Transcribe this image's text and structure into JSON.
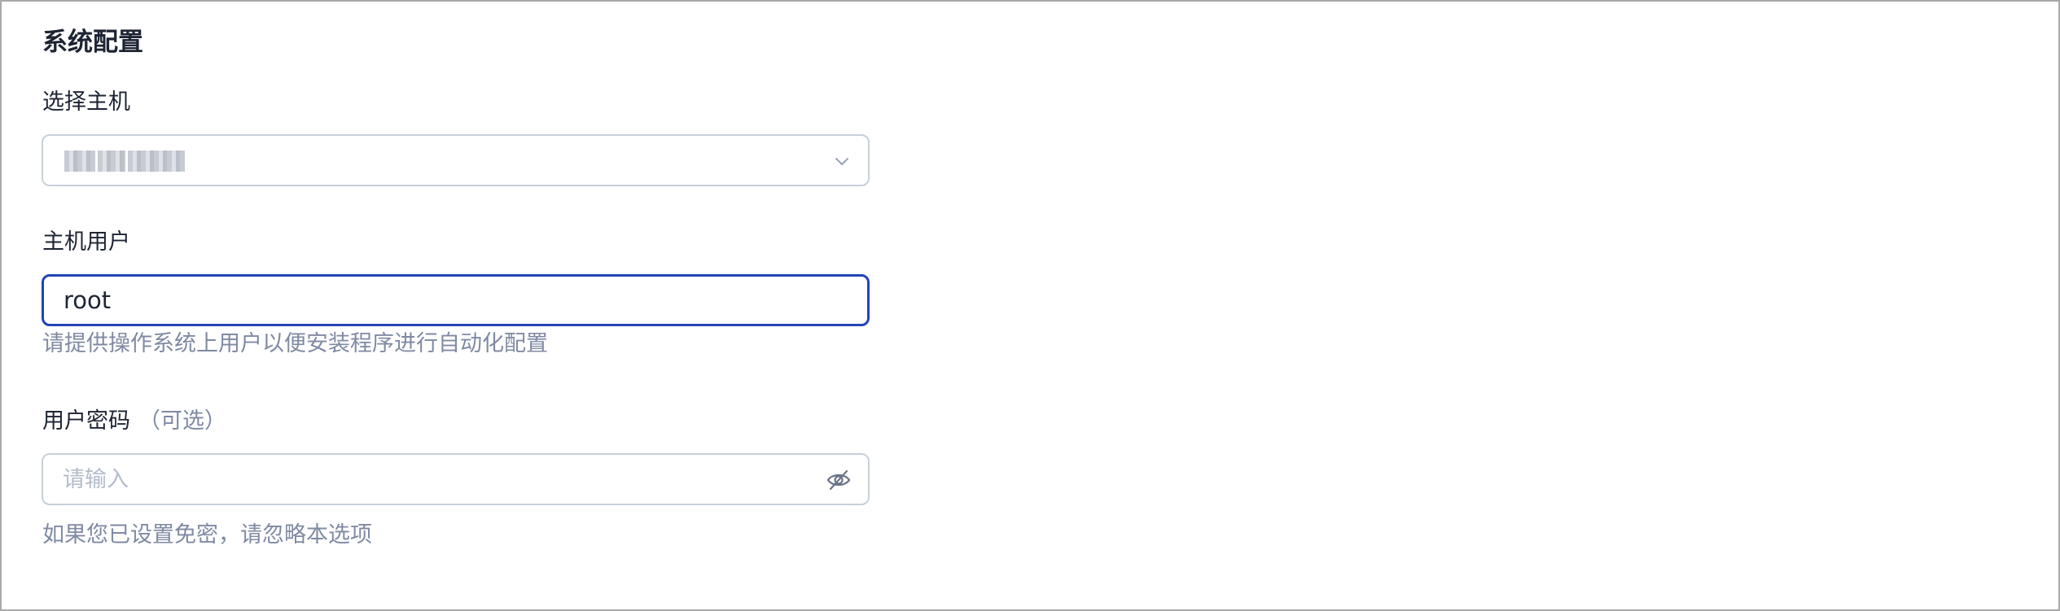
{
  "section": {
    "title": "系统配置"
  },
  "host": {
    "label": "选择主机",
    "selected_value_obscured": "mc us root"
  },
  "host_user": {
    "label": "主机用户",
    "value": "root",
    "help": "请提供操作系统上用户以便安装程序进行自动化配置"
  },
  "password": {
    "label": "用户密码",
    "optional": "（可选）",
    "placeholder": "请输入",
    "help": "如果您已设置免密，请忽略本选项",
    "icon": "eye-off-icon"
  },
  "colors": {
    "focus_border": "#2244b7",
    "border": "#c8cfdc",
    "muted_text": "#7f8aa3",
    "text": "#1d2433"
  }
}
